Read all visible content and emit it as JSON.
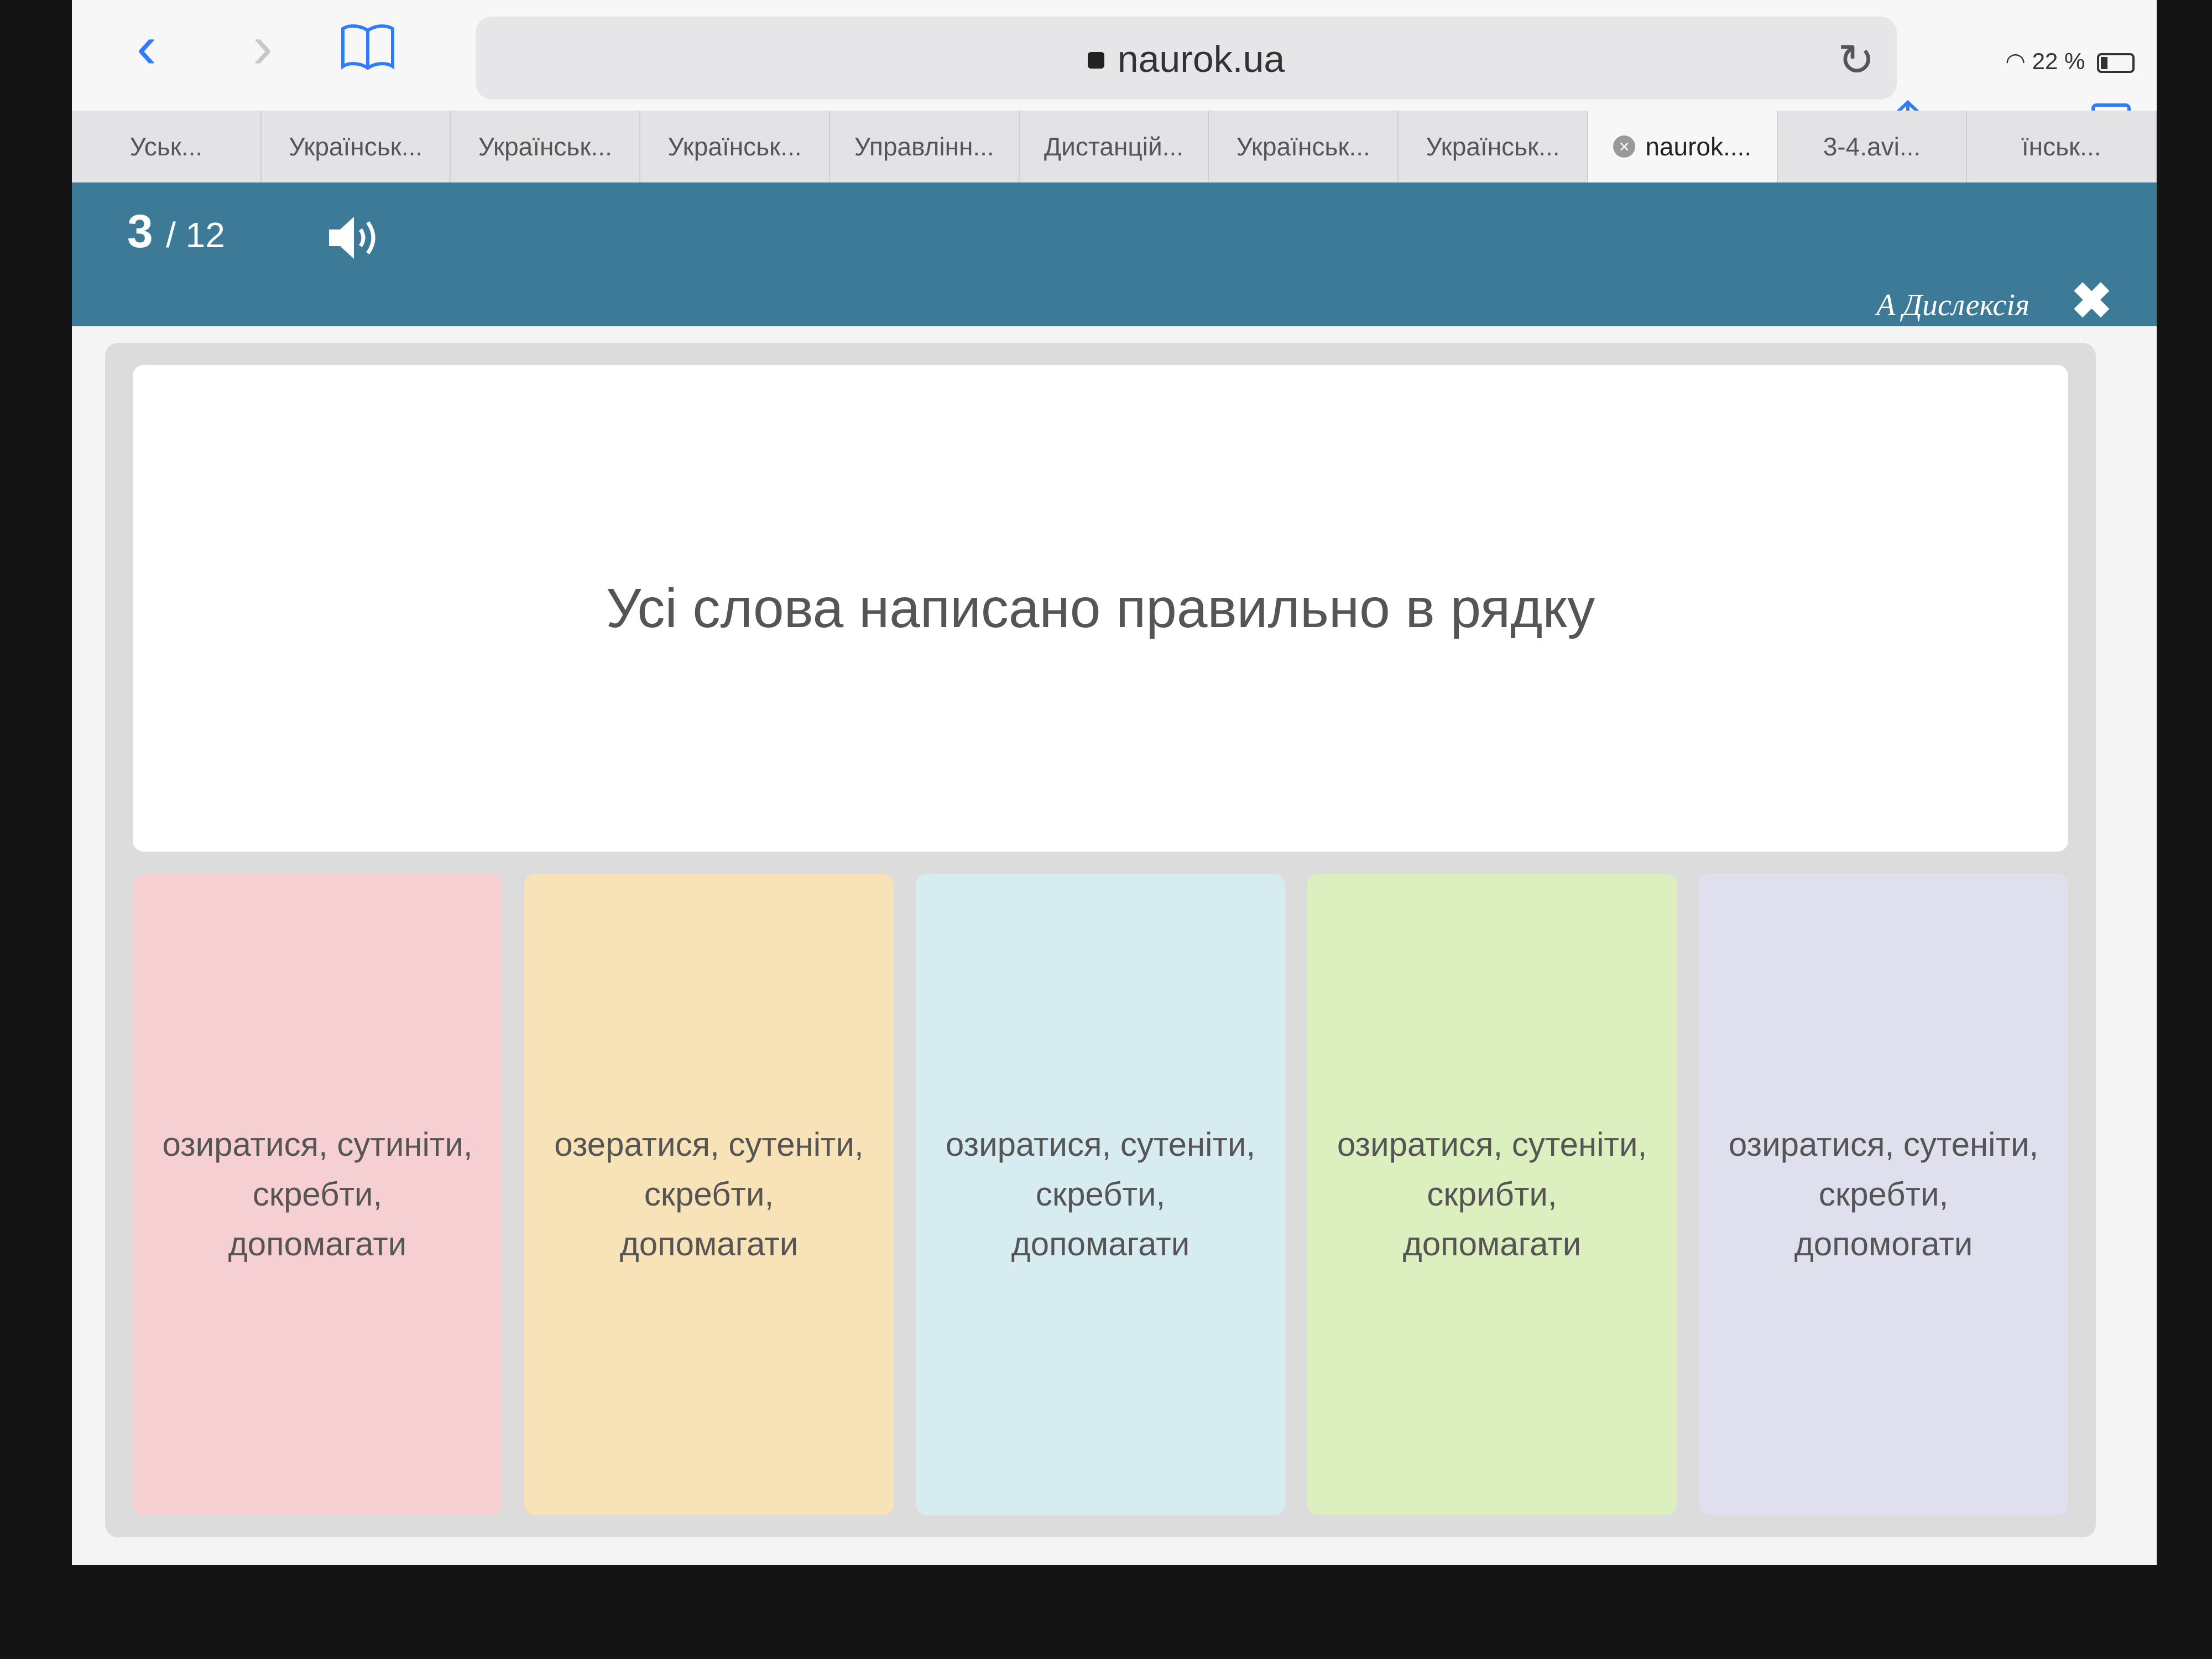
{
  "browser": {
    "url": "naurok.ua",
    "battery": "22 %",
    "tabs": [
      "Уськ...",
      "Українськ...",
      "Українськ...",
      "Українськ...",
      "Управлінн...",
      "Дистанцій...",
      "Українськ...",
      "Українськ...",
      "naurok....",
      "3-4.avi...",
      "їнськ..."
    ],
    "active_tab_index": 8
  },
  "app": {
    "progress_current": "3",
    "progress_total": "/ 12",
    "dyslexia_label": "A Дислексія"
  },
  "question": {
    "text": "Усі слова написано правильно в рядку"
  },
  "answers": [
    {
      "lines": [
        "озиратися, сутиніти,",
        "скребти,",
        "допомагати"
      ],
      "color": "#f6cfd3"
    },
    {
      "lines": [
        "озератися, сутеніти,",
        "скребти,",
        "допомагати"
      ],
      "color": "#f8e2b7"
    },
    {
      "lines": [
        "озиратися, сутеніти,",
        "скребти,",
        "допомагати"
      ],
      "color": "#d6ecf1"
    },
    {
      "lines": [
        "озиратися, сутеніти,",
        "скрибти,",
        "допомагати"
      ],
      "color": "#dcf0bf"
    },
    {
      "lines": [
        "озиратися, сутеніти,",
        "скребти,",
        "допомогати"
      ],
      "color": "#dfdfee"
    }
  ],
  "icons": {
    "back": "chevron-left-icon",
    "forward": "chevron-right-icon",
    "bookmarks": "book-icon",
    "reload": "reload-icon",
    "share": "share-icon",
    "new_tab": "plus-icon",
    "tabs": "tabs-icon",
    "sound": "speaker-icon",
    "close": "close-icon"
  }
}
